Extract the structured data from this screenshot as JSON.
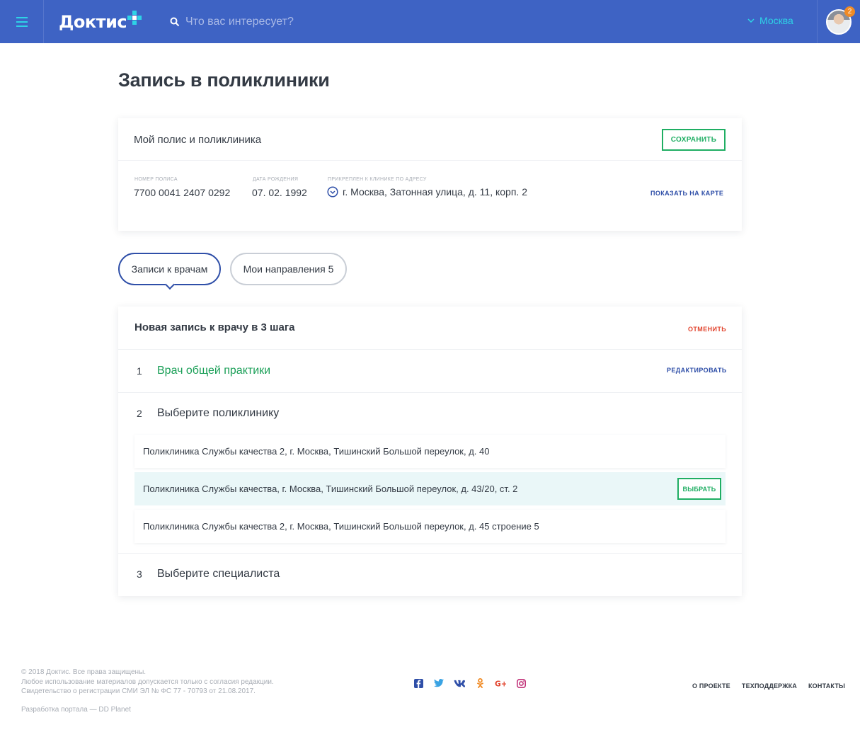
{
  "header": {
    "logo": "Доктис",
    "search_placeholder": "Что вас интересует?",
    "city": "Москва",
    "notifications_count": "2"
  },
  "page": {
    "title": "Запись в поликлиники"
  },
  "policy": {
    "title": "Мой полис и поликлиника",
    "save_label": "СОХРАНИТЬ",
    "number_label": "НОМЕР ПОЛИСА",
    "number_value": "7700 0041 2407 0292",
    "birth_label": "ДАТА РОЖДЕНИЯ",
    "birth_value": "07. 02. 1992",
    "address_label": "ПРИКРЕПЛЕН К КЛИНИКЕ ПО АДРЕСУ",
    "address_value": "г. Москва, Затонная улица, д. 11, корп. 2",
    "map_link": "ПОКАЗАТЬ НА КАРТЕ"
  },
  "tabs": [
    {
      "label": "Записи к врачам"
    },
    {
      "label": "Мои направления 5"
    }
  ],
  "appointment": {
    "title": "Новая запись к врачу в 3 шага",
    "cancel_label": "ОТМЕНИТЬ",
    "steps": [
      {
        "num": "1",
        "title": "Врач общей практики",
        "edit_label": "РЕДАКТИРОВАТЬ"
      },
      {
        "num": "2",
        "title": "Выберите поликлинику"
      },
      {
        "num": "3",
        "title": "Выберите специалиста"
      }
    ],
    "clinics": [
      {
        "name": "Поликлиника Службы качества 2, г. Москва, Тишинский Большой переулок, д. 40"
      },
      {
        "name": "Поликлиника Службы качества, г. Москва, Тишинский Большой переулок, д. 43/20, ст. 2",
        "choose_label": "ВЫБРАТЬ"
      },
      {
        "name": "Поликлиника Службы качества 2, г. Москва, Тишинский Большой переулок, д. 45 строение 5"
      }
    ]
  },
  "footer": {
    "copyright": "© 2018 Доктис. Все права защищены.",
    "usage": "Любое использование материалов допускается только с согласия редакции.",
    "registration": "Свидетельство о регистрации СМИ ЭЛ № ФС 77 - 70793 от 21.08.2017.",
    "developer": "Разработка портала — DD Planet",
    "links": [
      "О ПРОЕКТЕ",
      "ТЕХПОДДЕРЖКА",
      "КОНТАКТЫ"
    ],
    "socials": [
      "facebook-icon",
      "twitter-icon",
      "vk-icon",
      "odnoklassniki-icon",
      "google-plus-icon",
      "instagram-icon"
    ]
  },
  "colors": {
    "header_bg": "#3e63c4",
    "accent_cyan": "#2ed3e6",
    "green": "#1fae63",
    "blue_link": "#2f4fa8",
    "red_link": "#e2452f"
  }
}
